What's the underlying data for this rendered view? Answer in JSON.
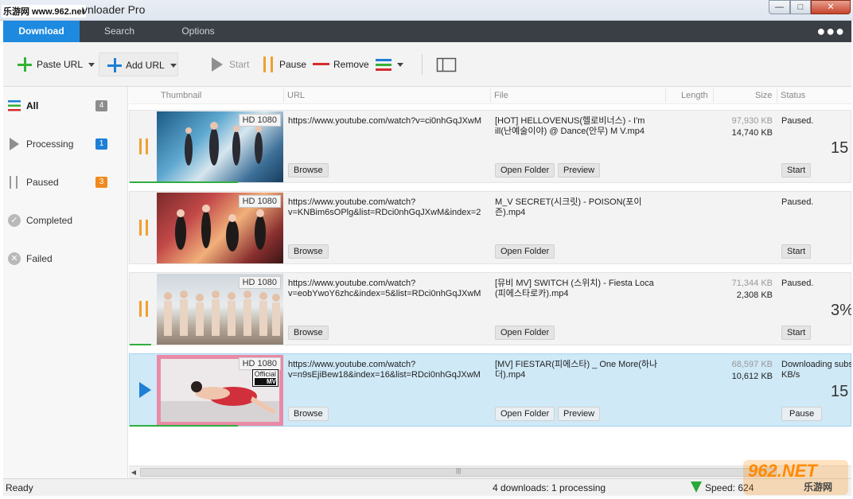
{
  "window": {
    "watermark": "乐游网 www.962.net",
    "title": "vnloader Pro",
    "controls": {
      "minimize": "—",
      "maximize": "□",
      "close": "✕"
    }
  },
  "tabs": [
    {
      "label": "Download",
      "active": true
    },
    {
      "label": "Search",
      "active": false
    },
    {
      "label": "Options",
      "active": false
    }
  ],
  "tabbar": {
    "more": "●●●"
  },
  "toolbar": {
    "paste_url": "Paste URL",
    "add_url": "Add URL",
    "start": "Start",
    "pause": "Pause",
    "remove": "Remove"
  },
  "sidebar": {
    "items": [
      {
        "label": "All",
        "count": "4",
        "badge_color": "#8c8c8c",
        "icon": "list-icon"
      },
      {
        "label": "Processing",
        "count": "1",
        "badge_color": "#1d7fd6",
        "icon": "play-icon"
      },
      {
        "label": "Paused",
        "count": "3",
        "badge_color": "#ef8a1e",
        "icon": "pause-icon"
      },
      {
        "label": "Completed",
        "count": "",
        "badge_color": "",
        "icon": "check-circle-icon"
      },
      {
        "label": "Failed",
        "count": "",
        "badge_color": "",
        "icon": "x-circle-icon"
      }
    ]
  },
  "columns": {
    "thumbnail": "Thumbnail",
    "url": "URL",
    "file": "File",
    "length": "Length",
    "size": "Size",
    "status": "Status"
  },
  "downloads": [
    {
      "state": "paused",
      "quality": "HD 1080",
      "official": "",
      "url": "https://www.youtube.com/watch?v=ci0nhGqJXwM",
      "file": "[HOT] HELLOVENUS(헬로비너스) - I'm ill(난예술이야) @ Dance(안무) M  V.mp4",
      "size_total": "97,930 KB",
      "size_done": "14,740 KB",
      "status": "Paused.",
      "progress_text": "15",
      "progress": 0.15,
      "buttons": {
        "browse": "Browse",
        "open_folder": "Open Folder",
        "preview": "Preview",
        "action": "Start"
      }
    },
    {
      "state": "paused",
      "quality": "HD 1080",
      "official": "",
      "url": "https://www.youtube.com/watch?v=KNBim6sOPlg&list=RDci0nhGqJXwM&index=2",
      "file": "M_V SECRET(시크릿) - POISON(포이즌).mp4",
      "size_total": "",
      "size_done": "",
      "status": "Paused.",
      "progress_text": "",
      "progress": 0.0,
      "buttons": {
        "browse": "Browse",
        "open_folder": "Open Folder",
        "preview": "",
        "action": "Start"
      }
    },
    {
      "state": "paused",
      "quality": "HD 1080",
      "official": "",
      "url": "https://www.youtube.com/watch?v=eobYwoY6zhc&index=5&list=RDci0nhGqJXwM",
      "file": "[뮤비 MV]  SWITCH (스위치) - Fiesta Loca (피에스타로카).mp4",
      "size_total": "71,344 KB",
      "size_done": "2,308 KB",
      "status": "Paused.",
      "progress_text": "3%",
      "progress": 0.03,
      "buttons": {
        "browse": "Browse",
        "open_folder": "Open Folder",
        "preview": "",
        "action": "Start"
      }
    },
    {
      "state": "downloading",
      "quality": "HD 1080",
      "official": "Official",
      "official_sub": "MV",
      "url": "https://www.youtube.com/watch?v=n9sEjiBew18&index=16&list=RDci0nhGqJXwM",
      "file": "[MV] FIESTAR(피에스타) _ One More(하나 더).mp4",
      "size_total": "68,597 KB",
      "size_done": "10,612 KB",
      "status": "Downloading subs KB/s",
      "progress_text": "15",
      "progress": 0.15,
      "buttons": {
        "browse": "Browse",
        "open_folder": "Open Folder",
        "preview": "Preview",
        "action": "Pause"
      }
    }
  ],
  "statusbar": {
    "ready": "Ready",
    "summary": "4 downloads: 1 processing",
    "speed": "Speed: 624"
  },
  "site_logo": {
    "main": "962.NET",
    "sub": "乐游网"
  },
  "colors": {
    "accent": "#1d8ae0",
    "tabbar": "#3a3f46",
    "paused": "#f0a030",
    "progress": "#2fae3f",
    "selected_row": "#cfe9f7"
  }
}
